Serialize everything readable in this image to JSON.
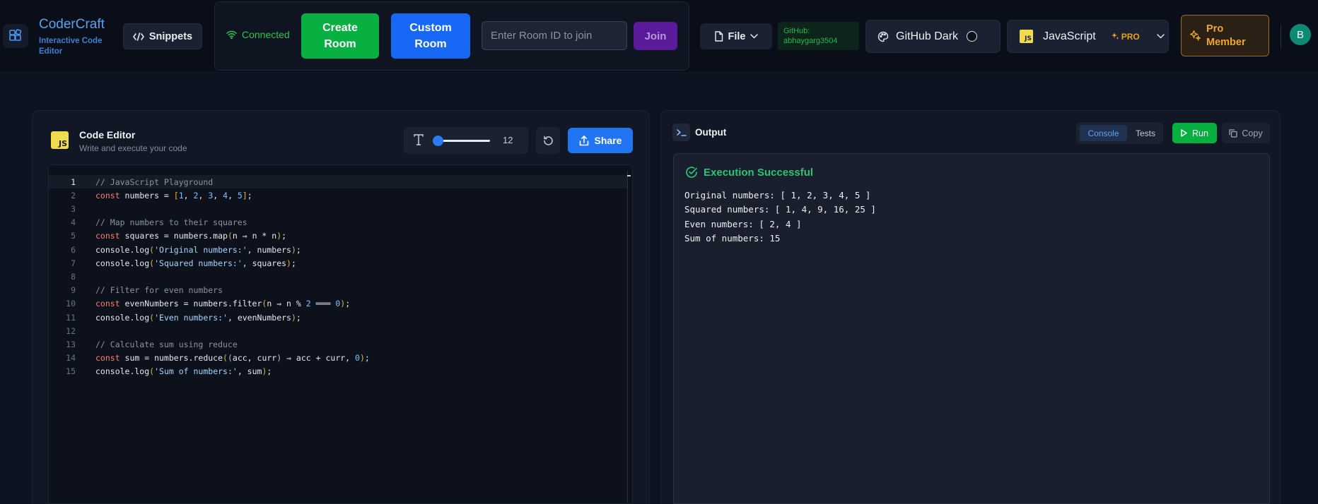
{
  "header": {
    "brand_name": "CoderCraft",
    "brand_sub": "Interactive Code Editor",
    "snippets_label": "Snippets",
    "status": "Connected",
    "create_room": "Create Room",
    "custom_room": "Custom Room",
    "room_placeholder": "Enter Room ID to join",
    "join_label": "Join",
    "file_label": "File",
    "github_line1": "GitHub:",
    "github_line2": "abhaygarg3504",
    "theme_label": "GitHub Dark",
    "language_label": "JavaScript",
    "pro_tag": "PRO",
    "pro_member": "Pro Member",
    "avatar_initial": "B"
  },
  "editor": {
    "icon_text": "JS",
    "title": "Code Editor",
    "subtitle": "Write and execute your code",
    "font_size": "12",
    "font_size_fraction": 0.0,
    "share_label": "Share",
    "active_line": 1,
    "lines": [
      [
        {
          "t": "// JavaScript Playground",
          "c": "comment"
        }
      ],
      [
        {
          "t": "const",
          "c": "kw"
        },
        {
          "t": " numbers = "
        },
        {
          "t": "[",
          "c": "p1"
        },
        {
          "t": "1",
          "c": "num"
        },
        {
          "t": ", "
        },
        {
          "t": "2",
          "c": "num"
        },
        {
          "t": ", "
        },
        {
          "t": "3",
          "c": "num"
        },
        {
          "t": ", "
        },
        {
          "t": "4",
          "c": "num"
        },
        {
          "t": ", "
        },
        {
          "t": "5",
          "c": "num"
        },
        {
          "t": "]",
          "c": "p1"
        },
        {
          "t": ";"
        }
      ],
      [],
      [
        {
          "t": "// Map numbers to their squares",
          "c": "comment"
        }
      ],
      [
        {
          "t": "const",
          "c": "kw"
        },
        {
          "t": " squares = numbers.map"
        },
        {
          "t": "(",
          "c": "p1"
        },
        {
          "t": "n ⇒ n * n"
        },
        {
          "t": ")",
          "c": "p1"
        },
        {
          "t": ";"
        }
      ],
      [
        {
          "t": "console.log"
        },
        {
          "t": "(",
          "c": "p1"
        },
        {
          "t": "'Original numbers:'",
          "c": "str"
        },
        {
          "t": ", numbers"
        },
        {
          "t": ")",
          "c": "p1"
        },
        {
          "t": ";"
        }
      ],
      [
        {
          "t": "console.log"
        },
        {
          "t": "(",
          "c": "p1"
        },
        {
          "t": "'Squared numbers:'",
          "c": "str"
        },
        {
          "t": ", squares"
        },
        {
          "t": ")",
          "c": "p1"
        },
        {
          "t": ";"
        }
      ],
      [],
      [
        {
          "t": "// Filter for even numbers",
          "c": "comment"
        }
      ],
      [
        {
          "t": "const",
          "c": "kw"
        },
        {
          "t": " evenNumbers = numbers.filter"
        },
        {
          "t": "(",
          "c": "p1"
        },
        {
          "t": "n ⇒ n % "
        },
        {
          "t": "2",
          "c": "num"
        },
        {
          "t": " ═══ "
        },
        {
          "t": "0",
          "c": "num"
        },
        {
          "t": ")",
          "c": "p1"
        },
        {
          "t": ";"
        }
      ],
      [
        {
          "t": "console.log"
        },
        {
          "t": "(",
          "c": "p1"
        },
        {
          "t": "'Even numbers:'",
          "c": "str"
        },
        {
          "t": ", evenNumbers"
        },
        {
          "t": ")",
          "c": "p1"
        },
        {
          "t": ";"
        }
      ],
      [],
      [
        {
          "t": "// Calculate sum using reduce",
          "c": "comment"
        }
      ],
      [
        {
          "t": "const",
          "c": "kw"
        },
        {
          "t": " sum = numbers.reduce"
        },
        {
          "t": "(",
          "c": "p1"
        },
        {
          "t": "(",
          "c": "p2"
        },
        {
          "t": "acc, curr"
        },
        {
          "t": ")",
          "c": "p2"
        },
        {
          "t": " ⇒ acc + curr, "
        },
        {
          "t": "0",
          "c": "num"
        },
        {
          "t": ")",
          "c": "p1"
        },
        {
          "t": ";"
        }
      ],
      [
        {
          "t": "console.log"
        },
        {
          "t": "(",
          "c": "p1"
        },
        {
          "t": "'Sum of numbers:'",
          "c": "str"
        },
        {
          "t": ", sum"
        },
        {
          "t": ")",
          "c": "p1"
        },
        {
          "t": ";"
        }
      ]
    ]
  },
  "output": {
    "title": "Output",
    "tab_console": "Console",
    "tab_tests": "Tests",
    "run_label": "Run",
    "copy_label": "Copy",
    "status": "Execution Successful",
    "lines": [
      "Original numbers: [ 1, 2, 3, 4, 5 ]",
      "Squared numbers: [ 1, 4, 9, 16, 25 ]",
      "Even numbers: [ 2, 4 ]",
      "Sum of numbers: 15"
    ]
  },
  "colors": {
    "accent_blue": "#1668f5",
    "success_green": "#07b040",
    "join_purple": "#5a1a9a",
    "pro_gold": "#eea72a"
  }
}
